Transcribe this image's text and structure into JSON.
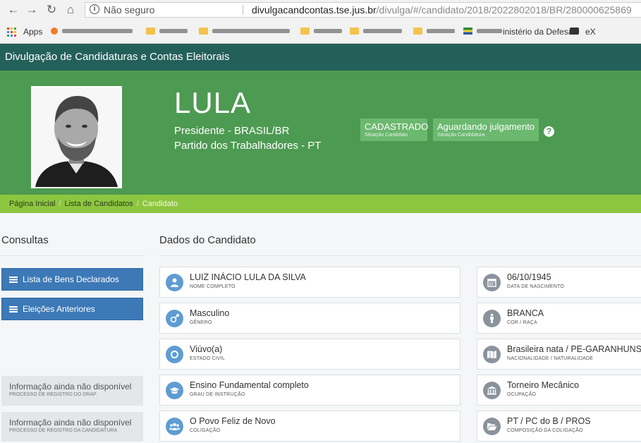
{
  "browser": {
    "info_icon": "i",
    "security_text": "Não seguro",
    "host": "divulgacandcontas.tse.jus.br",
    "path": "/divulga/#/candidato/2018/2022802018/BR/280000625869",
    "bookmarks": {
      "apps_label": "Apps",
      "defesa_label": "inistério da Defesa",
      "ext_label": "eX"
    }
  },
  "site": {
    "title": "Divulgação de Candidaturas e Contas Eleitorais"
  },
  "candidate": {
    "ballot_name": "LULA",
    "office_line": "Presidente - BRASIL/BR",
    "party_line": "Partido dos Trabalhadores - PT",
    "status1": {
      "value": "CADASTRADO",
      "label": "Situação Candidato"
    },
    "status2": {
      "value": "Aguardando julgamento",
      "label": "Situação Candidatura"
    },
    "help_icon": "?"
  },
  "breadcrumb": {
    "home": "Página Inicial",
    "list": "Lista de Candidatos",
    "current": "Candidato"
  },
  "sidebar": {
    "title": "Consultas",
    "buttons": [
      "Lista de Bens Declarados",
      "Eleições Anteriores"
    ],
    "info": [
      {
        "value": "Informação ainda não disponível",
        "label": "PROCESSO DE REGISTRO DO DRAP"
      },
      {
        "value": "Informação ainda não disponível",
        "label": "PROCESSO DE REGISTRO DA CANDIDATURA"
      }
    ]
  },
  "details": {
    "title": "Dados do Candidato",
    "left": [
      {
        "value": "LUIZ INÁCIO LULA DA SILVA",
        "label": "NOME COMPLETO",
        "icon": "user-icon"
      },
      {
        "value": "Masculino",
        "label": "GÊNERO",
        "icon": "gender-icon"
      },
      {
        "value": "Viúvo(a)",
        "label": "ESTADO CIVIL",
        "icon": "ring-icon"
      },
      {
        "value": "Ensino Fundamental completo",
        "label": "GRAU DE INSTRUÇÃO",
        "icon": "graduation-cap-icon"
      },
      {
        "value": "O Povo Feliz de Novo",
        "label": "COLIGAÇÃO",
        "icon": "group-icon"
      }
    ],
    "right": [
      {
        "value": "06/10/1945",
        "label": "DATA DE NASCIMENTO",
        "icon": "calendar-icon"
      },
      {
        "value": "BRANCA",
        "label": "COR / RAÇA",
        "icon": "person-icon"
      },
      {
        "value": "Brasileira nata / PE-GARANHUNS",
        "label": "NACIONALIDADE / NATURALIDADE",
        "icon": "map-icon"
      },
      {
        "value": "Torneiro Mecânico",
        "label": "OCUPAÇÃO",
        "icon": "institution-icon"
      },
      {
        "value": "PT / PC do B / PROS",
        "label": "COMPOSIÇÃO DA COLIGAÇÃO",
        "icon": "folder-open-icon"
      }
    ]
  },
  "colors": {
    "header_teal": "#24605a",
    "hero_green": "#4d9a52",
    "breadcrumb_green": "#8dc63f",
    "button_blue": "#3d79b6",
    "icon_blue": "#5e9cd3",
    "icon_gray": "#8a939c"
  }
}
